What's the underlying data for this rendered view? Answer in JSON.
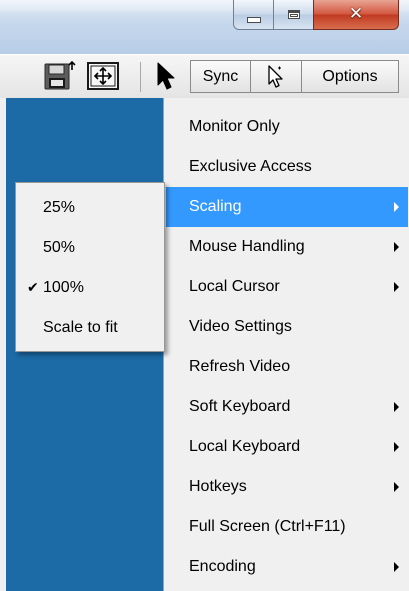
{
  "toolbar": {
    "sync_label": "Sync",
    "options_label": "Options"
  },
  "menu": {
    "items": [
      {
        "label": "Monitor Only",
        "submenu": false
      },
      {
        "label": "Exclusive Access",
        "submenu": false
      },
      {
        "label": "Scaling",
        "submenu": true,
        "highlighted": true
      },
      {
        "label": "Mouse Handling",
        "submenu": true
      },
      {
        "label": "Local Cursor",
        "submenu": true
      },
      {
        "label": "Video Settings",
        "submenu": false
      },
      {
        "label": "Refresh Video",
        "submenu": false
      },
      {
        "label": "Soft Keyboard",
        "submenu": true
      },
      {
        "label": "Local Keyboard",
        "submenu": true
      },
      {
        "label": "Hotkeys",
        "submenu": true
      },
      {
        "label": "Full Screen (Ctrl+F11)",
        "submenu": false
      },
      {
        "label": "Encoding",
        "submenu": true
      }
    ]
  },
  "scaling_submenu": {
    "items": [
      {
        "label": "25%",
        "checked": false
      },
      {
        "label": "50%",
        "checked": false
      },
      {
        "label": "100%",
        "checked": true
      },
      {
        "label": "Scale to fit",
        "checked": false
      }
    ],
    "check_glyph": "✔"
  },
  "icons": {
    "save": "floppy-disk-icon",
    "fullscreen": "move-arrows-icon",
    "pointer": "cursor-arrow-icon",
    "pointer_outline": "cursor-outline-icon"
  },
  "colors": {
    "desktop": "#1c6aa6",
    "menu_highlight": "#3399ff",
    "close_button": "#c9452a"
  }
}
